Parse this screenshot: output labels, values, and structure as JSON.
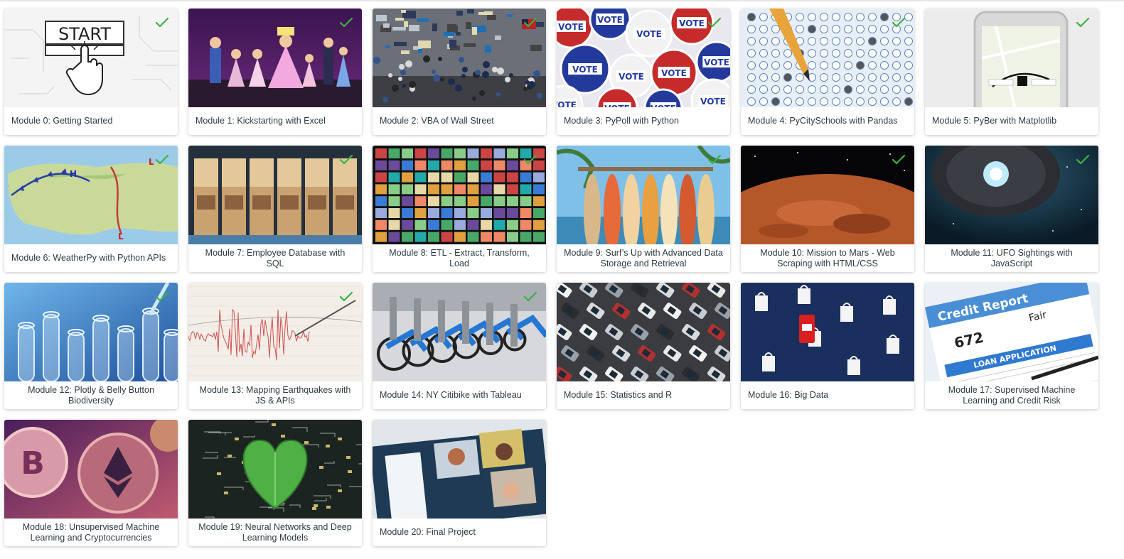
{
  "colors": {
    "check": "#3bb143",
    "label_text": "#2d3b45",
    "card_bg": "#ffffff"
  },
  "modules": [
    {
      "title": "Module 0: Getting Started",
      "completed": true,
      "thumbnail": "start-button-circuit"
    },
    {
      "title": "Module 1: Kickstarting with Excel",
      "completed": true,
      "thumbnail": "theater-performers"
    },
    {
      "title": "Module 2: VBA of Wall Street",
      "completed": true,
      "thumbnail": "stock-exchange-floor"
    },
    {
      "title": "Module 3: PyPoll with Python",
      "completed": true,
      "thumbnail": "vote-buttons"
    },
    {
      "title": "Module 4: PyCitySchools with Pandas",
      "completed": true,
      "thumbnail": "bubble-sheet-pencil"
    },
    {
      "title": "Module 5: PyBer with Matplotlib",
      "completed": true,
      "thumbnail": "phone-rideshare-map"
    },
    {
      "title": "Module 6: WeatherPy with Python APIs",
      "completed": true,
      "thumbnail": "weather-map"
    },
    {
      "title": "Module 7: Employee Database with SQL",
      "completed": true,
      "thumbnail": "office-windows"
    },
    {
      "title": "Module 8: ETL - Extract, Transform, Load",
      "completed": true,
      "thumbnail": "video-wall"
    },
    {
      "title": "Module 9: Surf’s Up with Advanced Data Storage and Retrieval",
      "completed": true,
      "thumbnail": "surfboards"
    },
    {
      "title": "Module 10: Mission to Mars - Web Scraping with HTML/CSS",
      "completed": true,
      "thumbnail": "mars-planet"
    },
    {
      "title": "Module 11: UFO Sightings with JavaScript",
      "completed": true,
      "thumbnail": "ufo"
    },
    {
      "title": "Module 12: Plotly & Belly Button Biodiversity",
      "completed": true,
      "thumbnail": "test-tubes"
    },
    {
      "title": "Module 13: Mapping Earthquakes with JS & APIs",
      "completed": true,
      "thumbnail": "seismograph"
    },
    {
      "title": "Module 14: NY Citibike with Tableau",
      "completed": true,
      "thumbnail": "citibikes"
    },
    {
      "title": "Module 15: Statistics and R",
      "completed": false,
      "thumbnail": "parking-lot-cars"
    },
    {
      "title": "Module 16: Big Data",
      "completed": false,
      "thumbnail": "shopping-bags-phone"
    },
    {
      "title": "Module 17: Supervised Machine Learning and Credit Risk",
      "completed": false,
      "thumbnail": "credit-report"
    },
    {
      "title": "Module 18: Unsupervised Machine Learning and Cryptocurrencies",
      "completed": false,
      "thumbnail": "crypto-coins"
    },
    {
      "title": "Module 19: Neural Networks and Deep Learning Models",
      "completed": false,
      "thumbnail": "leaf-circuit"
    },
    {
      "title": "Module 20: Final Project",
      "completed": false,
      "thumbnail": "video-call-laptop"
    }
  ]
}
